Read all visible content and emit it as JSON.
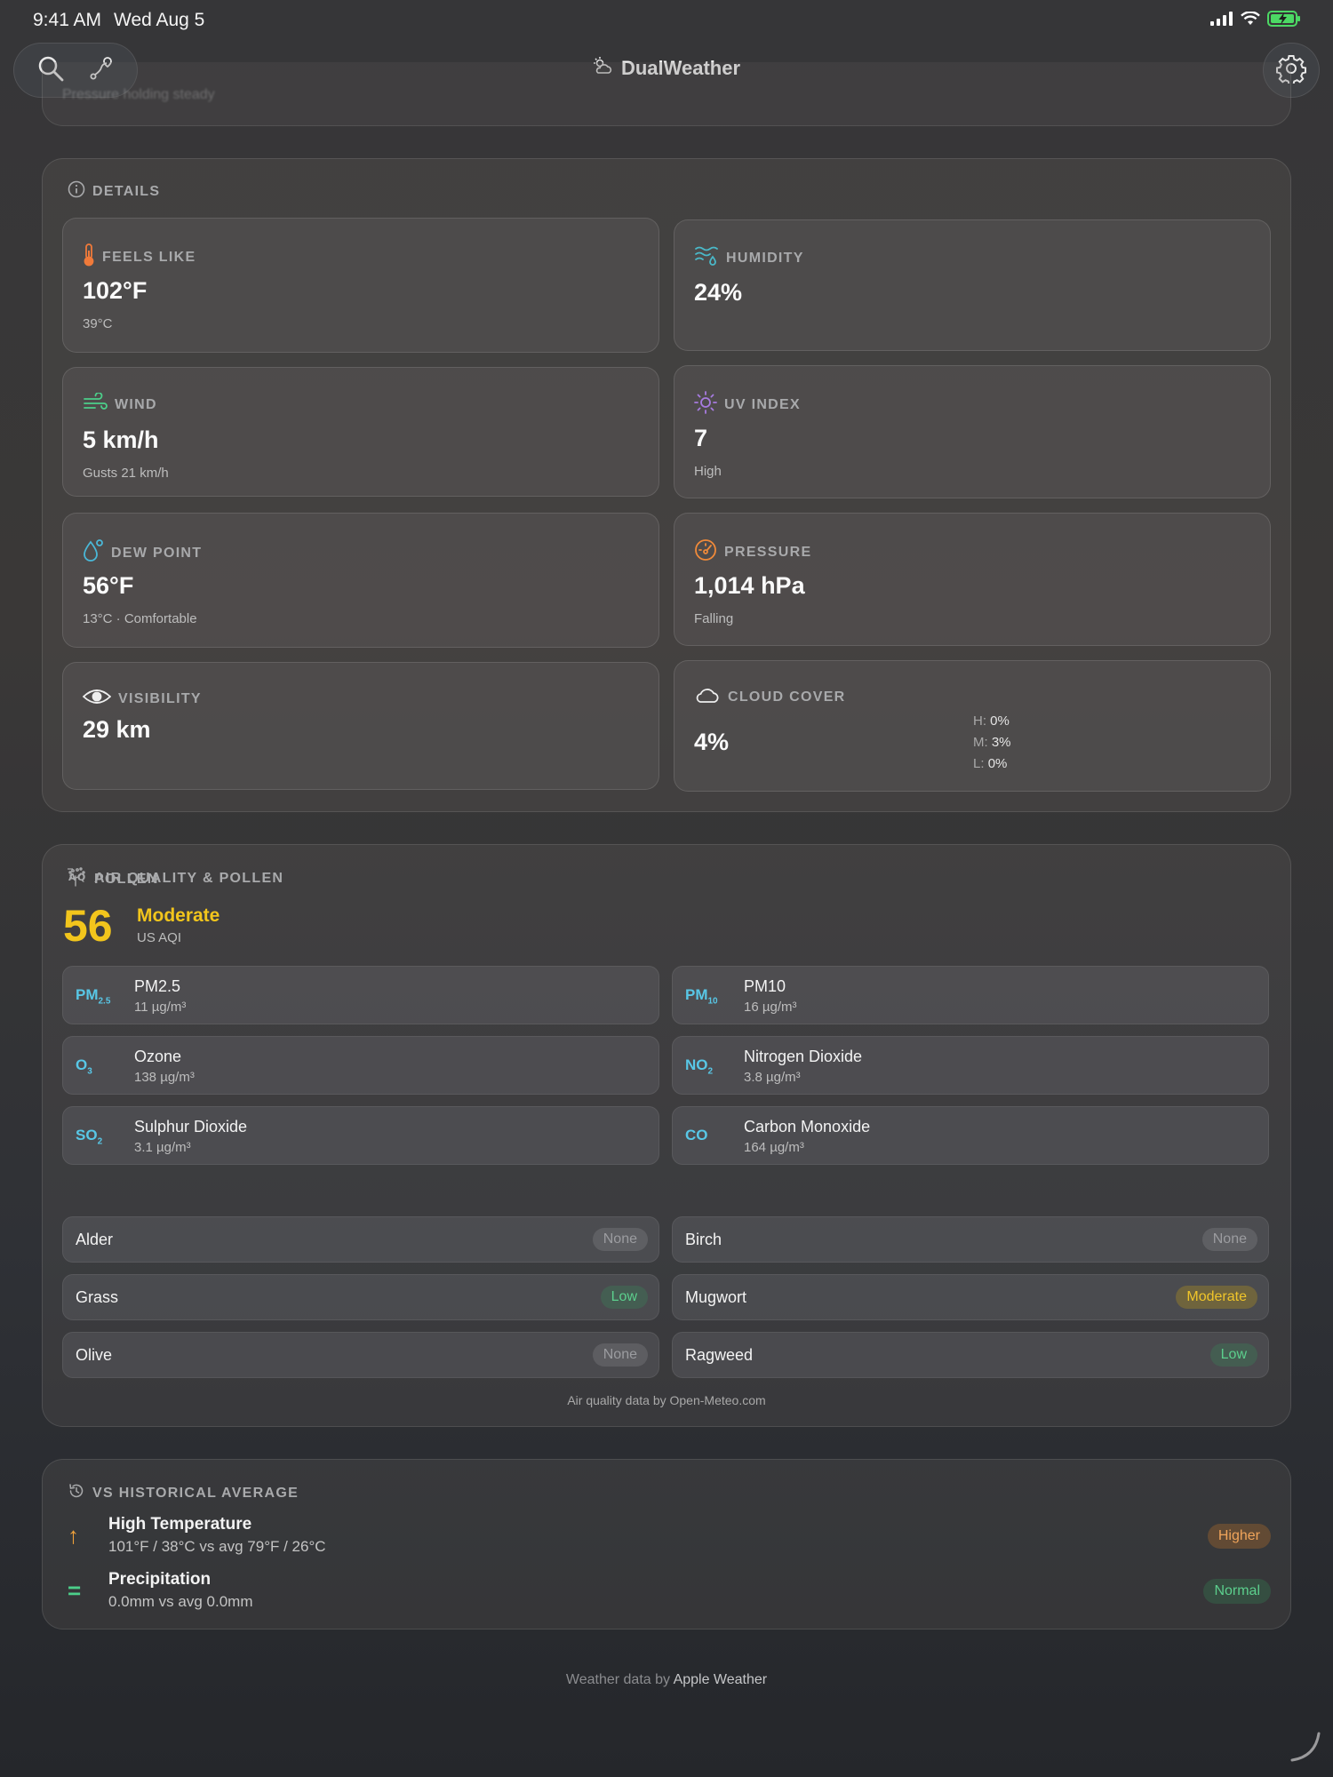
{
  "status_bar": {
    "time": "9:41 AM",
    "date": "Wed Aug 5"
  },
  "header": {
    "title": "DualWeather",
    "search_icon": "search-icon",
    "route_icon": "route-icon",
    "settings_icon": "gear-icon"
  },
  "previous_card": {
    "text": "Pressure holding steady"
  },
  "details": {
    "heading": "DETAILS",
    "feels_like": {
      "label": "FEELS LIKE",
      "value": "102°F",
      "sub": "39°C"
    },
    "humidity": {
      "label": "HUMIDITY",
      "value": "24%"
    },
    "wind": {
      "label": "WIND",
      "value": "5 km/h",
      "sub": "Gusts 21 km/h"
    },
    "uv_index": {
      "label": "UV INDEX",
      "value": "7",
      "sub": "High"
    },
    "dew_point": {
      "label": "DEW POINT",
      "value": "56°F",
      "sub": "13°C · Comfortable"
    },
    "pressure": {
      "label": "PRESSURE",
      "value": "1,014 hPa",
      "sub": "Falling"
    },
    "visibility": {
      "label": "VISIBILITY",
      "value": "29 km"
    },
    "cloud_cover": {
      "label": "CLOUD COVER",
      "value": "4%",
      "high_key": "H:",
      "high": "0%",
      "mid_key": "M:",
      "mid": "3%",
      "low_key": "L:",
      "low": "0%"
    }
  },
  "air_quality": {
    "heading": "AIR QUALITY & POLLEN",
    "aqi": "56",
    "category": "Moderate",
    "unit": "US AQI",
    "pollutants": [
      {
        "symbol": "PM",
        "sub": "2.5",
        "name": "PM2.5",
        "value": "11 µg/m³"
      },
      {
        "symbol": "PM",
        "sub": "10",
        "name": "PM10",
        "value": "16 µg/m³"
      },
      {
        "symbol": "O",
        "sub": "3",
        "name": "Ozone",
        "value": "138 µg/m³"
      },
      {
        "symbol": "NO",
        "sub": "2",
        "name": "Nitrogen Dioxide",
        "value": "3.8 µg/m³"
      },
      {
        "symbol": "SO",
        "sub": "2",
        "name": "Sulphur Dioxide",
        "value": "3.1 µg/m³"
      },
      {
        "symbol": "CO",
        "sub": "",
        "name": "Carbon Monoxide",
        "value": "164 µg/m³"
      }
    ],
    "pollen_heading": "POLLEN",
    "pollen": [
      {
        "name": "Alder",
        "level": "None"
      },
      {
        "name": "Birch",
        "level": "None"
      },
      {
        "name": "Grass",
        "level": "Low"
      },
      {
        "name": "Mugwort",
        "level": "Moderate"
      },
      {
        "name": "Olive",
        "level": "None"
      },
      {
        "name": "Ragweed",
        "level": "Low"
      }
    ],
    "attribution": "Air quality data by Open-Meteo.com"
  },
  "historical": {
    "heading": "VS HISTORICAL AVERAGE",
    "rows": [
      {
        "icon": "↑",
        "title": "High Temperature",
        "sub": "101°F / 38°C vs avg 79°F / 26°C",
        "badge": "Higher"
      },
      {
        "icon": "=",
        "title": "Precipitation",
        "sub": "0.0mm vs avg 0.0mm",
        "badge": "Normal"
      }
    ]
  },
  "footer": {
    "prefix": "Weather data by",
    "link": "Apple Weather"
  },
  "colors": {
    "accent_yellow": "#f2c51c",
    "pollutant_cyan": "#58c7e6",
    "good_green": "#5ccf8d",
    "warn_orange": "#f0a45a"
  }
}
